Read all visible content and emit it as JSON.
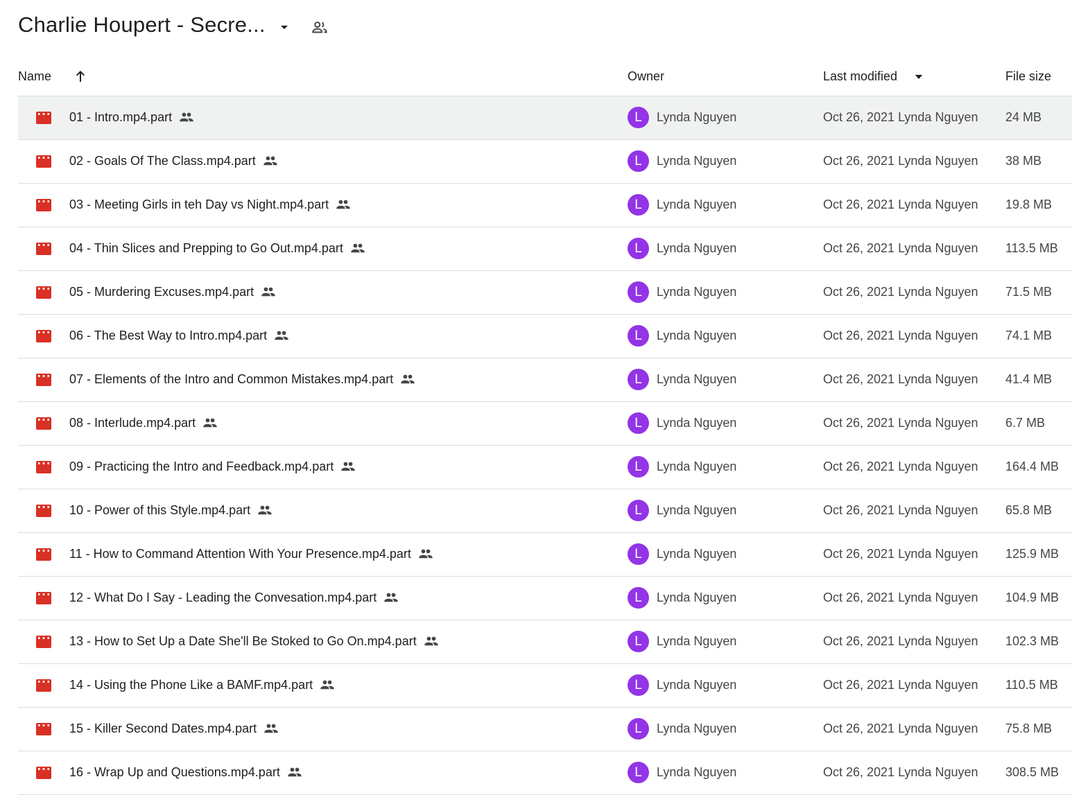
{
  "folder": {
    "title": "Charlie Houpert - Secre..."
  },
  "columns": {
    "name": "Name",
    "owner": "Owner",
    "last_modified": "Last modified",
    "file_size": "File size"
  },
  "colors": {
    "file_icon": "#d93025",
    "avatar": "#9334e6",
    "selected_row": "#f0f2f1"
  },
  "icons": {
    "title_dropdown": "caret-down-icon",
    "title_shared": "people-outline-icon",
    "sort": "arrow-up-icon",
    "file": "video-file-icon",
    "shared": "people-icon"
  },
  "files": [
    {
      "name": "01 - Intro.mp4.part",
      "owner_initial": "L",
      "owner": "Lynda Nguyen",
      "modified": "Oct 26, 2021 Lynda Nguyen",
      "size": "24 MB"
    },
    {
      "name": "02 - Goals Of The Class.mp4.part",
      "owner_initial": "L",
      "owner": "Lynda Nguyen",
      "modified": "Oct 26, 2021 Lynda Nguyen",
      "size": "38 MB"
    },
    {
      "name": "03 - Meeting Girls in teh Day vs Night.mp4.part",
      "owner_initial": "L",
      "owner": "Lynda Nguyen",
      "modified": "Oct 26, 2021 Lynda Nguyen",
      "size": "19.8 MB"
    },
    {
      "name": "04 - Thin Slices and Prepping to Go Out.mp4.part",
      "owner_initial": "L",
      "owner": "Lynda Nguyen",
      "modified": "Oct 26, 2021 Lynda Nguyen",
      "size": "113.5 MB"
    },
    {
      "name": "05 - Murdering Excuses.mp4.part",
      "owner_initial": "L",
      "owner": "Lynda Nguyen",
      "modified": "Oct 26, 2021 Lynda Nguyen",
      "size": "71.5 MB"
    },
    {
      "name": "06 - The Best Way to Intro.mp4.part",
      "owner_initial": "L",
      "owner": "Lynda Nguyen",
      "modified": "Oct 26, 2021 Lynda Nguyen",
      "size": "74.1 MB"
    },
    {
      "name": "07 - Elements of the Intro and Common Mistakes.mp4.part",
      "owner_initial": "L",
      "owner": "Lynda Nguyen",
      "modified": "Oct 26, 2021 Lynda Nguyen",
      "size": "41.4 MB"
    },
    {
      "name": "08 - Interlude.mp4.part",
      "owner_initial": "L",
      "owner": "Lynda Nguyen",
      "modified": "Oct 26, 2021 Lynda Nguyen",
      "size": "6.7 MB"
    },
    {
      "name": "09 - Practicing the Intro and Feedback.mp4.part",
      "owner_initial": "L",
      "owner": "Lynda Nguyen",
      "modified": "Oct 26, 2021 Lynda Nguyen",
      "size": "164.4 MB"
    },
    {
      "name": "10 - Power of this Style.mp4.part",
      "owner_initial": "L",
      "owner": "Lynda Nguyen",
      "modified": "Oct 26, 2021 Lynda Nguyen",
      "size": "65.8 MB"
    },
    {
      "name": "11 - How to Command Attention With Your Presence.mp4.part",
      "owner_initial": "L",
      "owner": "Lynda Nguyen",
      "modified": "Oct 26, 2021 Lynda Nguyen",
      "size": "125.9 MB"
    },
    {
      "name": "12 - What Do I Say - Leading the Convesation.mp4.part",
      "owner_initial": "L",
      "owner": "Lynda Nguyen",
      "modified": "Oct 26, 2021 Lynda Nguyen",
      "size": "104.9 MB"
    },
    {
      "name": "13 - How to Set Up a Date She'll Be Stoked to Go On.mp4.part",
      "owner_initial": "L",
      "owner": "Lynda Nguyen",
      "modified": "Oct 26, 2021 Lynda Nguyen",
      "size": "102.3 MB"
    },
    {
      "name": "14 - Using the Phone Like a BAMF.mp4.part",
      "owner_initial": "L",
      "owner": "Lynda Nguyen",
      "modified": "Oct 26, 2021 Lynda Nguyen",
      "size": "110.5 MB"
    },
    {
      "name": "15 - Killer Second Dates.mp4.part",
      "owner_initial": "L",
      "owner": "Lynda Nguyen",
      "modified": "Oct 26, 2021 Lynda Nguyen",
      "size": "75.8 MB"
    },
    {
      "name": "16 - Wrap Up and Questions.mp4.part",
      "owner_initial": "L",
      "owner": "Lynda Nguyen",
      "modified": "Oct 26, 2021 Lynda Nguyen",
      "size": "308.5 MB"
    }
  ]
}
